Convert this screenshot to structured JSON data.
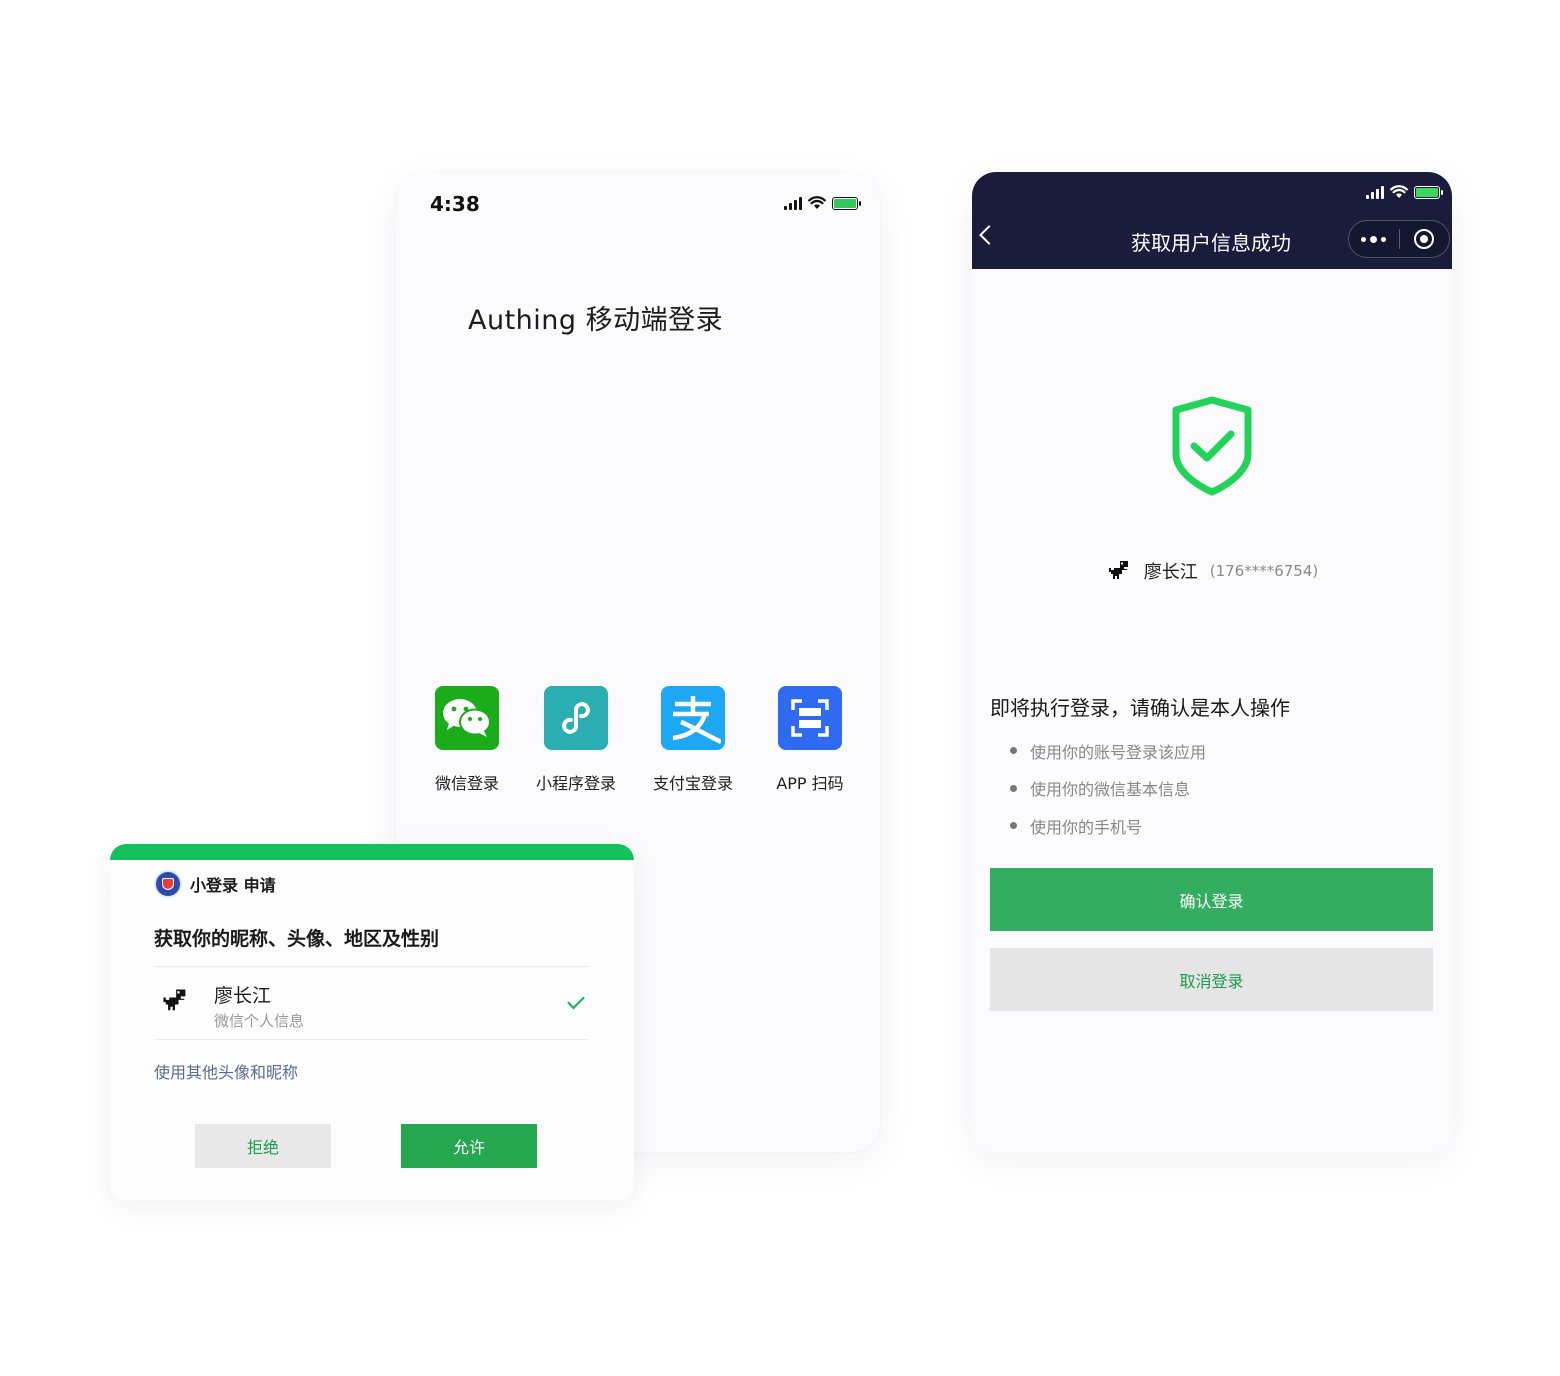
{
  "login_phone": {
    "status_time": "4:38",
    "title": "Authing 移动端登录",
    "options": [
      {
        "label": "微信登录",
        "icon": "wechat-icon",
        "color": "#1aad19"
      },
      {
        "label": "小程序登录",
        "icon": "miniprogram-icon",
        "color": "#2aaeb1"
      },
      {
        "label": "支付宝登录",
        "icon": "alipay-icon",
        "color": "#1ea7f2"
      },
      {
        "label": "APP 扫码",
        "icon": "scan-icon",
        "color": "#2f6af0"
      }
    ]
  },
  "success_phone": {
    "nav_title": "获取用户信息成功",
    "user_name": "廖长江",
    "user_phone": "(176****6754)",
    "confirm_text": "即将执行登录，请确认是本人操作",
    "permissions": [
      "使用你的账号登录该应用",
      "使用你的微信基本信息",
      "使用你的手机号"
    ],
    "confirm_button": "确认登录",
    "cancel_button": "取消登录",
    "colors": {
      "header": "#1b1c3b",
      "shield": "#22d35a",
      "confirm": "#33ae61"
    }
  },
  "auth_dialog": {
    "app_name": "小登录 申请",
    "title": "获取你的昵称、头像、地区及性别",
    "user_name": "廖长江",
    "user_sub": "微信个人信息",
    "alt_link": "使用其他头像和昵称",
    "reject_button": "拒绝",
    "allow_button": "允许",
    "colors": {
      "top_bar": "#14c05b",
      "allow": "#24a74f",
      "link": "#576b95"
    }
  }
}
